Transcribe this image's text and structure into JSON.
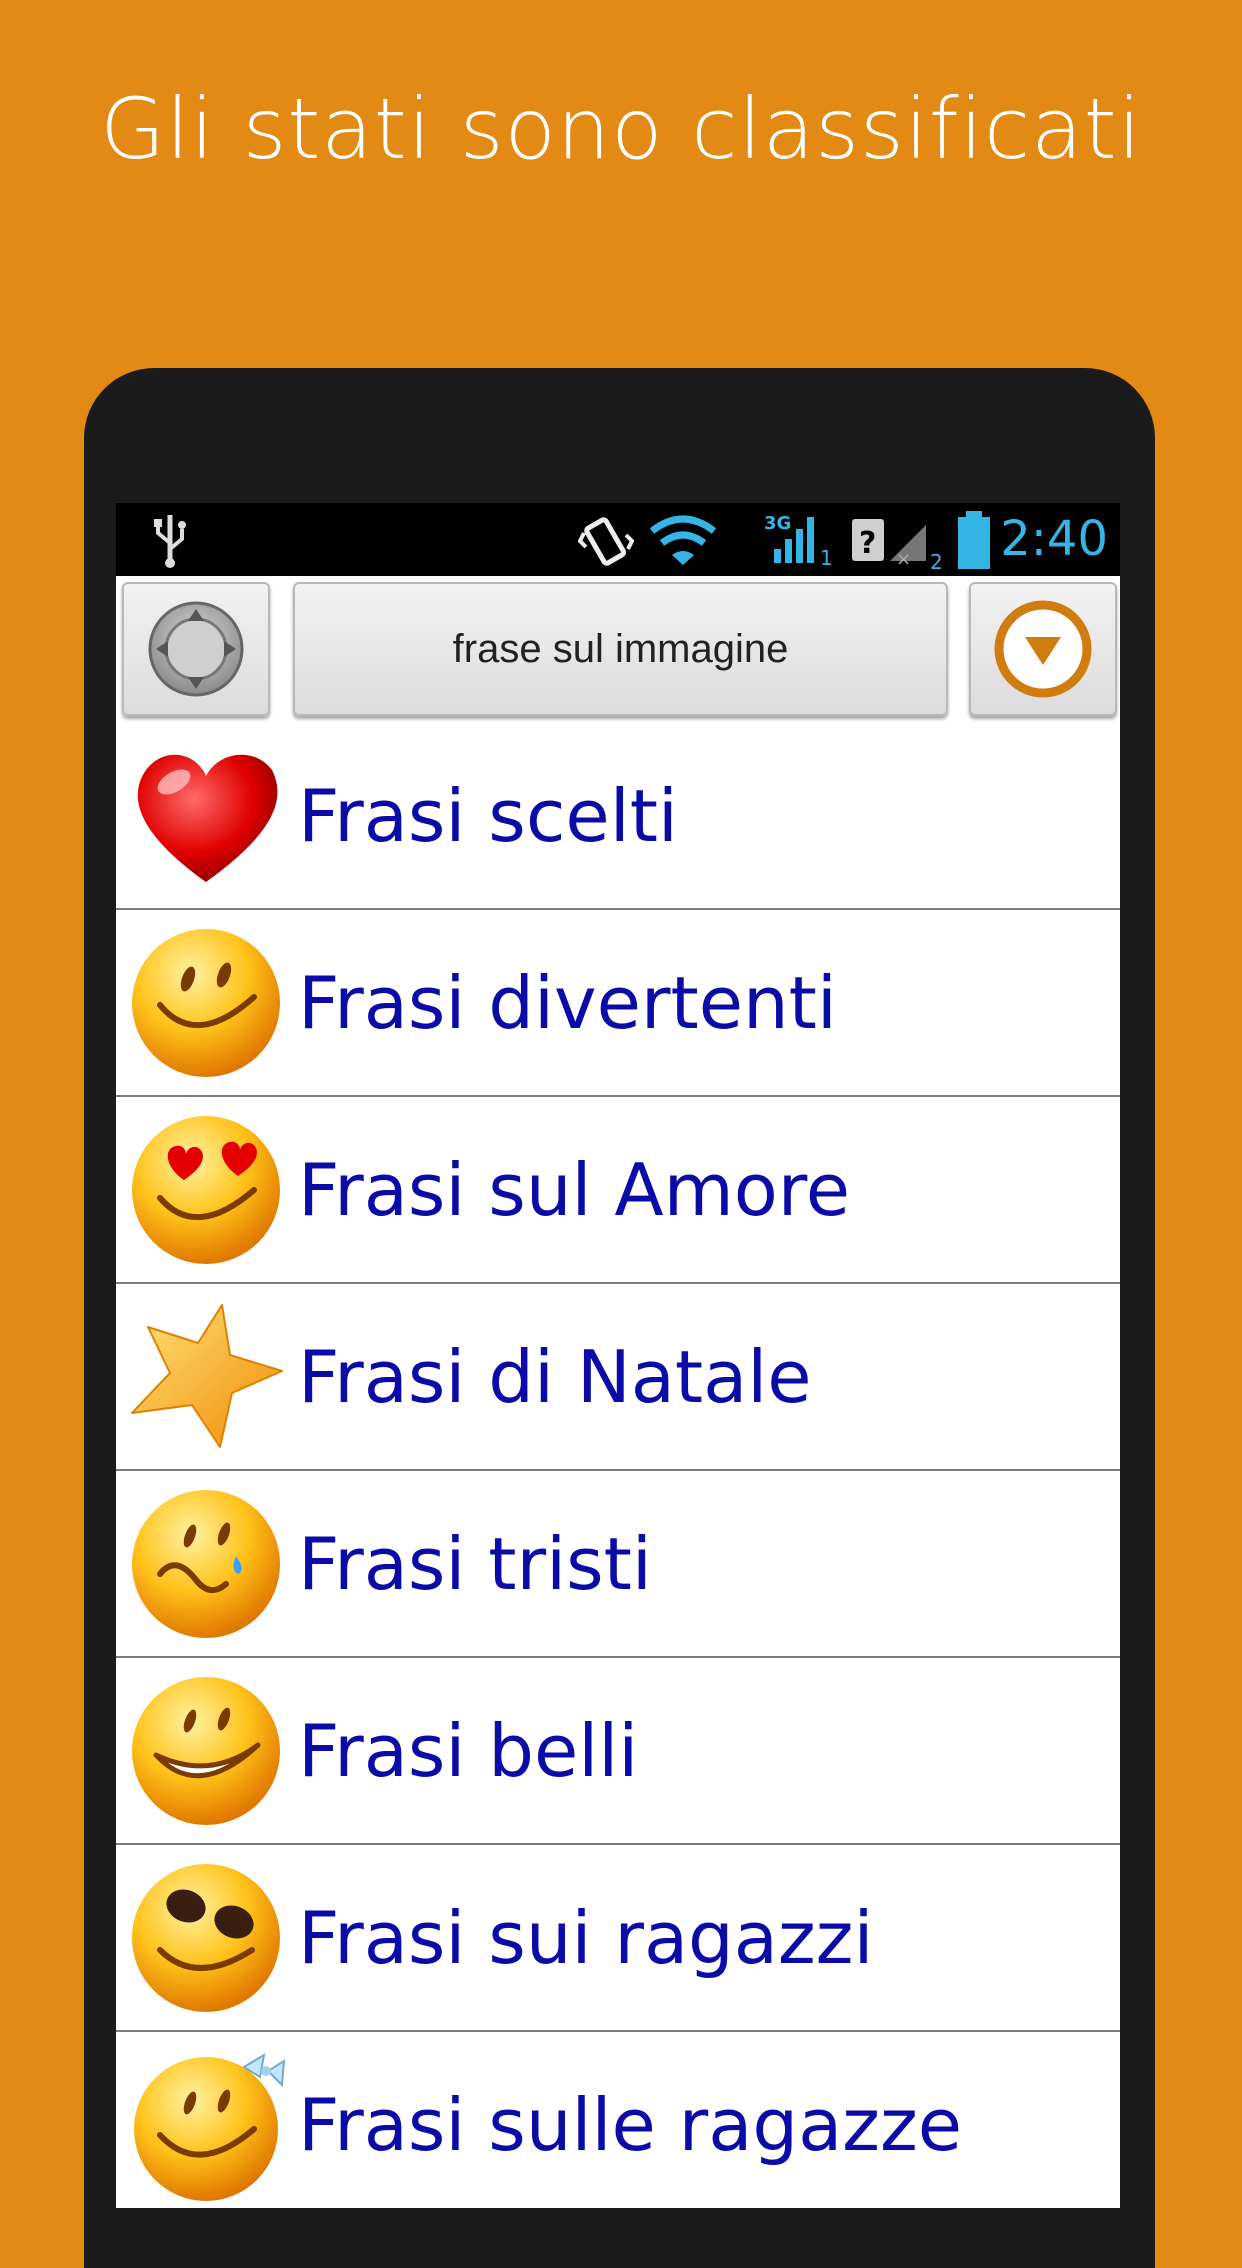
{
  "headline": "Gli stati sono classificati",
  "status_bar": {
    "time": "2:40",
    "icons": [
      "usb-icon",
      "vibrate-icon",
      "wifi-icon",
      "signal-3g-icon",
      "signal-sim2-icon",
      "battery-icon"
    ]
  },
  "toolbar": {
    "left_icon": "crosshair-menu-icon",
    "title_button": "frase sul immagine",
    "right_icon": "dropdown-circle-icon"
  },
  "categories": [
    {
      "label": "Frasi scelti",
      "icon": "heart-icon"
    },
    {
      "label": "Frasi divertenti",
      "icon": "smiley-wink-icon"
    },
    {
      "label": "Frasi sul Amore",
      "icon": "heart-eyes-smiley-icon"
    },
    {
      "label": "Frasi di Natale",
      "icon": "star-icon"
    },
    {
      "label": "Frasi tristi",
      "icon": "crying-smiley-icon"
    },
    {
      "label": "Frasi belli",
      "icon": "grin-smiley-icon"
    },
    {
      "label": "Frasi sui ragazzi",
      "icon": "sunglasses-smiley-icon"
    },
    {
      "label": "Frasi sulle ragazze",
      "icon": "bow-smiley-icon"
    }
  ],
  "colors": {
    "background": "#E38A14",
    "list_text": "#0B0BA8",
    "clock": "#35B5E5"
  }
}
